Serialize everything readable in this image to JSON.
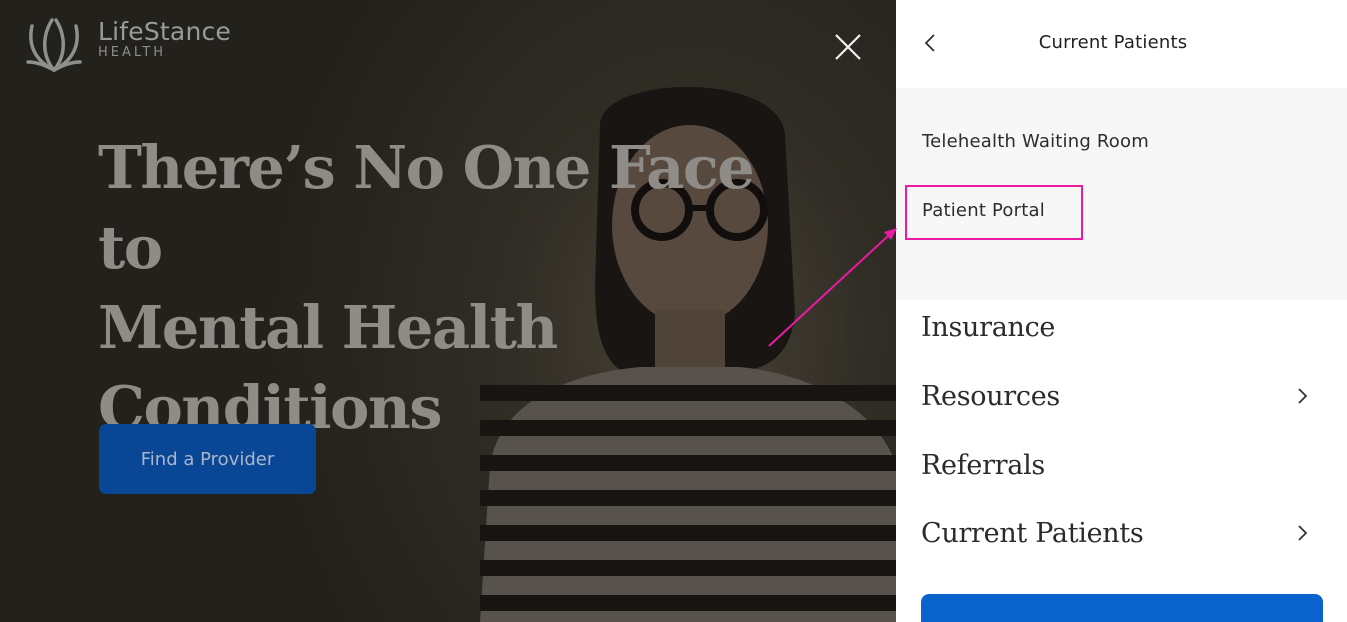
{
  "brand": {
    "name": "LifeStance",
    "sub": "HEALTH"
  },
  "hero": {
    "headline_line1": "There’s No One Face to",
    "headline_line2": "Mental Health",
    "headline_line3": "Conditions",
    "cta_label": "Find a Provider"
  },
  "drawer": {
    "title": "Current Patients",
    "submenu": [
      {
        "label": "Telehealth Waiting Room"
      },
      {
        "label": "Patient Portal",
        "highlighted": true
      }
    ],
    "menu": [
      {
        "label": "Insurance",
        "has_children": false
      },
      {
        "label": "Resources",
        "has_children": true
      },
      {
        "label": "Referrals",
        "has_children": false
      },
      {
        "label": "Current Patients",
        "has_children": true
      }
    ]
  },
  "colors": {
    "cta_blue": "#0a4696",
    "drawer_cta_blue": "#0a63cc",
    "annotation_magenta": "#ea1aa4"
  },
  "icons": [
    "lifestance-logo-icon",
    "close-icon",
    "back-chevron-icon",
    "chevron-right-icon"
  ]
}
